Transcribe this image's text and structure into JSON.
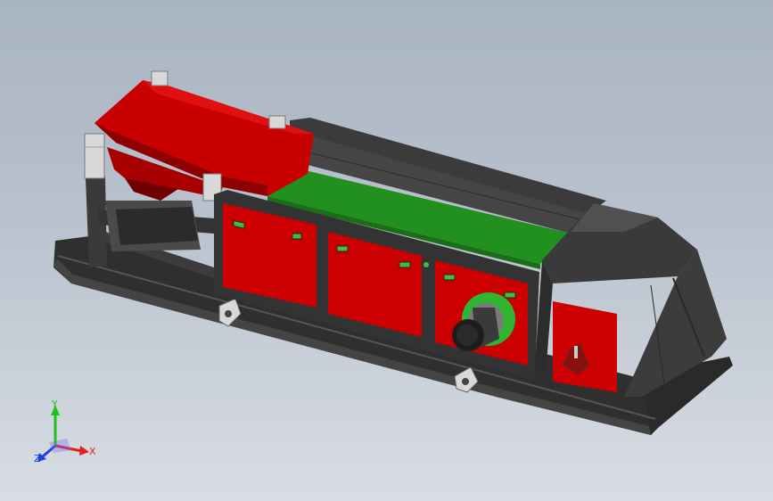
{
  "viewport": {
    "background_top": "#a9b4c2",
    "background_bottom": "#d9dde3"
  },
  "model": {
    "body_color": "#cc0000",
    "belt_color": "#22901f",
    "frame_color": "#3a3a3a",
    "indicator_color": "#3fbf3f",
    "hub_color": "#2fb52f",
    "hopper_mount_color": "#d8d8d8"
  },
  "triad": {
    "x_label": "X",
    "y_label": "Y",
    "z_label": "Z",
    "x_color": "#e02020",
    "y_color": "#20c020",
    "z_color": "#2040e0"
  }
}
